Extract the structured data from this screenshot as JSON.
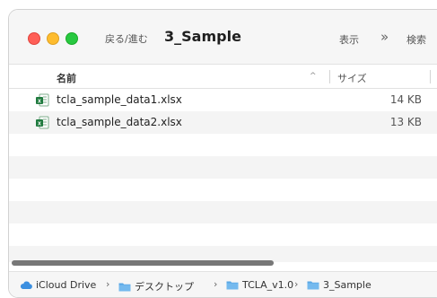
{
  "toolbar": {
    "back_forward_label": "戻る/進む",
    "folder_title": "3_Sample",
    "view_label": "表示",
    "more_label": "»",
    "search_label": "検索"
  },
  "columns": {
    "name": "名前",
    "size": "サイズ",
    "sort_indicator": "^"
  },
  "files": [
    {
      "name": "tcla_sample_data1.xlsx",
      "size": "14 KB",
      "icon": "excel-file-icon"
    },
    {
      "name": "tcla_sample_data2.xlsx",
      "size": "13 KB",
      "icon": "excel-file-icon"
    }
  ],
  "path": [
    {
      "label": "iCloud Drive",
      "icon": "cloud-icon"
    },
    {
      "label": "デスクトップ",
      "icon": "folder-icon"
    },
    {
      "label": "TCLA_v1.0",
      "icon": "folder-icon"
    },
    {
      "label": "3_Sample",
      "icon": "folder-icon"
    }
  ],
  "path_separator": "›",
  "colors": {
    "traffic_red": "#ff5f57",
    "traffic_yellow": "#febc2e",
    "traffic_green": "#28c840",
    "folder_blue": "#5aa8e6",
    "excel_green": "#1f7a3e"
  }
}
